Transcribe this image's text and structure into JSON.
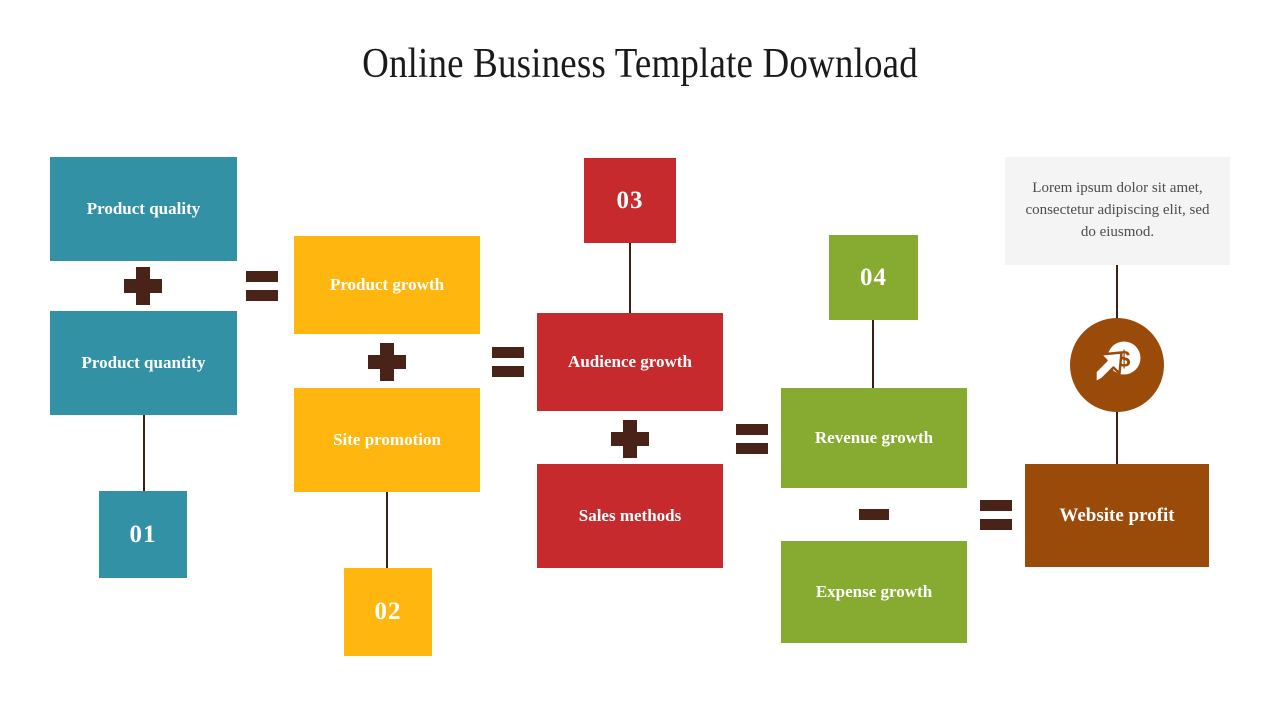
{
  "slide": {
    "title": "Online Business Template Download",
    "background": "#ffffff"
  },
  "palette": {
    "teal": "#3391a6",
    "amber": "#ffb710",
    "red": "#c62a2c",
    "green": "#87ab31",
    "brown": "#9a4a09",
    "operator": "#4a2318",
    "connector": "#3d1f16",
    "note_bg": "#f4f4f4",
    "note_text": "#4d4d4d",
    "title_text": "#1a1a1a",
    "box_text": "#ffffff"
  },
  "groups": [
    {
      "id": "group-01",
      "color": "#3391a6",
      "number": "01",
      "boxes": [
        {
          "label": "Product quality"
        },
        {
          "label": "Product quantity"
        }
      ]
    },
    {
      "id": "group-02",
      "color": "#ffb710",
      "number": "02",
      "boxes": [
        {
          "label": "Product growth"
        },
        {
          "label": "Site promotion"
        }
      ]
    },
    {
      "id": "group-03",
      "color": "#c62a2c",
      "number": "03",
      "boxes": [
        {
          "label": "Audience growth"
        },
        {
          "label": "Sales methods"
        }
      ]
    },
    {
      "id": "group-04",
      "color": "#87ab31",
      "number": "04",
      "boxes": [
        {
          "label": "Revenue growth"
        },
        {
          "label": "Expense growth"
        }
      ]
    },
    {
      "id": "group-result",
      "color": "#9a4a09",
      "boxes": [
        {
          "label": "Website profit"
        }
      ]
    }
  ],
  "operators": [
    {
      "id": "plus-1",
      "symbol": "+"
    },
    {
      "id": "equals-1",
      "symbol": "="
    },
    {
      "id": "plus-2",
      "symbol": "+"
    },
    {
      "id": "equals-2",
      "symbol": "="
    },
    {
      "id": "plus-3",
      "symbol": "+"
    },
    {
      "id": "equals-3",
      "symbol": "="
    },
    {
      "id": "minus-1",
      "symbol": "−"
    },
    {
      "id": "equals-4",
      "symbol": "="
    }
  ],
  "note": {
    "text": "Lorem ipsum dolor sit amet, consectetur adipiscing elit, sed do eiusmod."
  },
  "icon": {
    "name": "money-growth-icon",
    "description": "dollar coin with rising arrow"
  }
}
